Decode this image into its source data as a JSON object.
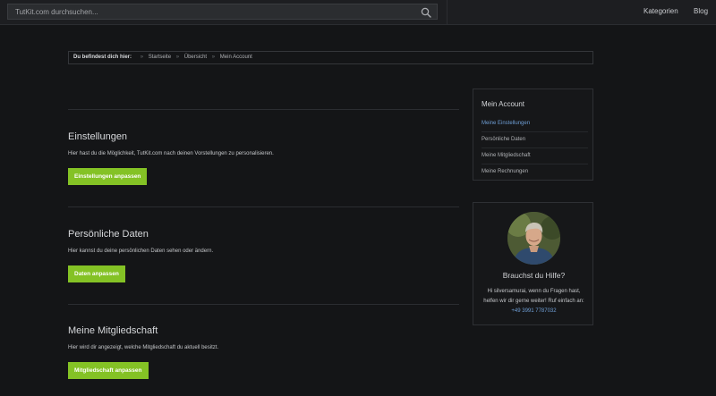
{
  "header": {
    "search_placeholder": "TutKit.com durchsuchen...",
    "nav": [
      "Kategorien",
      "Blog"
    ]
  },
  "breadcrumb": {
    "lead": "Du befindest dich hier:",
    "items": [
      "Startseite",
      "Übersicht",
      "Mein Account"
    ]
  },
  "sections": [
    {
      "title": "Einstellungen",
      "description": "Hier hast du die Möglichkeit, TutKit.com nach deinen Vorstellungen zu personalisieren.",
      "button": "Einstellungen anpassen"
    },
    {
      "title": "Persönliche Daten",
      "description": "Hier kannst du deine persönlichen Daten sehen oder ändern.",
      "button": "Daten anpassen"
    },
    {
      "title": "Meine Mitgliedschaft",
      "description": "Hier wird dir angezeigt, welche Mitgliedschaft du aktuell besitzt.",
      "button": "Mitgliedschaft anpassen"
    }
  ],
  "sidebar": {
    "account_title": "Mein Account",
    "links": [
      {
        "label": "Meine Einstellungen",
        "active": true
      },
      {
        "label": "Persönliche Daten",
        "active": false
      },
      {
        "label": "Meine Mitgliedschaft",
        "active": false
      },
      {
        "label": "Meine Rechnungen",
        "active": false
      }
    ],
    "help": {
      "title": "Brauchst du Hilfe?",
      "text": "Hi silversamurai, wenn du Fragen hast, helfen wir dir gerne weiter! Ruf einfach an:",
      "phone": "+49 3991 7787032"
    }
  },
  "colors": {
    "accent_green": "#84c225",
    "link_blue": "#6f9fd6",
    "background": "#141517"
  }
}
